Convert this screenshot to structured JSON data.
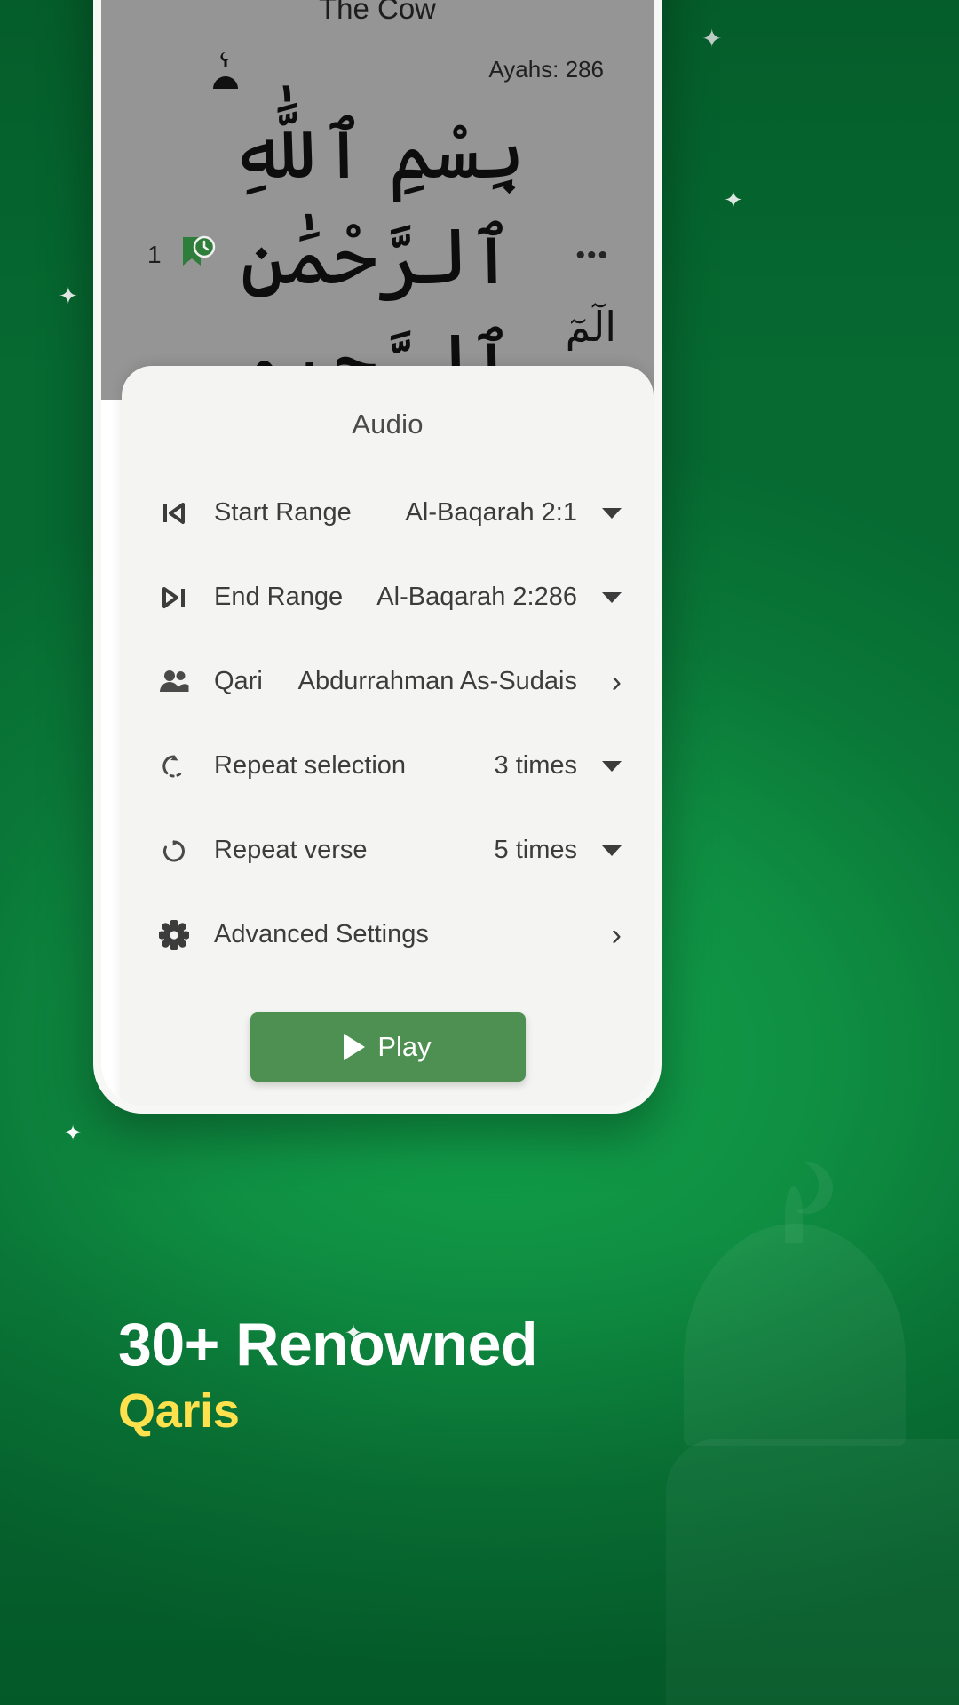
{
  "theme": {
    "brand_green": "#0f8e42",
    "play_green": "#4e9052",
    "accent_yellow": "#ffe14d",
    "sheet_bg": "#f4f4f3",
    "dim_overlay": "#959595"
  },
  "reader": {
    "surah_title": "The Cow",
    "ayahs_label": "Ayahs: 286",
    "bismillah": "بِسْمِ ٱللَّٰهِ ٱلرَّحْمَٰنِ ٱلرَّحِيمِ",
    "ayah_number": "1",
    "verse_text": "الٓمٓ",
    "overflow_menu": "•••",
    "mosque_icon": "mosque-icon",
    "bookmark_icon": "bookmark-clock-icon"
  },
  "sheet": {
    "title": "Audio",
    "rows": [
      {
        "icon": "skip-previous-icon",
        "label": "Start Range",
        "value": "Al-Baqarah 2:1",
        "tail": "caret"
      },
      {
        "icon": "skip-next-icon",
        "label": "End Range",
        "value": "Al-Baqarah 2:286",
        "tail": "caret"
      },
      {
        "icon": "people-icon",
        "label": "Qari",
        "value": "Abdurrahman As-Sudais",
        "tail": "chevron"
      },
      {
        "icon": "repeat-dashed-icon",
        "label": "Repeat selection",
        "value": "3 times",
        "tail": "caret"
      },
      {
        "icon": "rotate-left-icon",
        "label": "Repeat verse",
        "value": "5 times",
        "tail": "caret"
      },
      {
        "icon": "gear-icon",
        "label": "Advanced Settings",
        "value": "",
        "tail": "chevron"
      }
    ],
    "play_label": "Play",
    "play_icon": "play-icon"
  },
  "promo": {
    "headline": "30+ Renowned",
    "subline": "Qaris"
  }
}
